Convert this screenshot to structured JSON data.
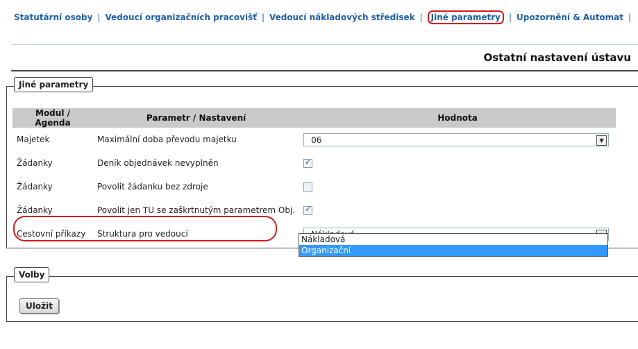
{
  "topnav": {
    "items": [
      "Statutární osoby",
      "Vedoucí organizačních pracovišť",
      "Vedoucí nákladových středisek",
      "Jiné parametry",
      "Upozornění & Automat"
    ],
    "separator": "|"
  },
  "page_title": "Ostatní nastavení ústavu",
  "section_params": {
    "legend": "Jiné parametry",
    "headers": {
      "module": "Modul / Agenda",
      "param": "Parametr / Nastavení",
      "value": "Hodnota"
    },
    "rows": [
      {
        "module": "Majetek",
        "param": "Maximální doba převodu majetku",
        "value": "06"
      },
      {
        "module": "Žádanky",
        "param": "Deník objednávek nevyplněn",
        "checked": true
      },
      {
        "module": "Žádanky",
        "param": "Povolit žádanku bez zdroje",
        "checked": false
      },
      {
        "module": "Žádanky",
        "param": "Povolit jen TU se zaškrtnutým parametrem Obj.",
        "checked": true
      },
      {
        "module": "Cestovní příkazy",
        "param": "Struktura pro vedoucí",
        "value": "Nákladová"
      }
    ],
    "dropdown_options": [
      "Nákladová",
      "Organizační"
    ]
  },
  "section_options": {
    "legend": "Volby",
    "save_label": "Uložit"
  },
  "colors": {
    "link": "#1f5fa8",
    "highlight": "#d41a1a",
    "option_selected": "#3399ff"
  }
}
